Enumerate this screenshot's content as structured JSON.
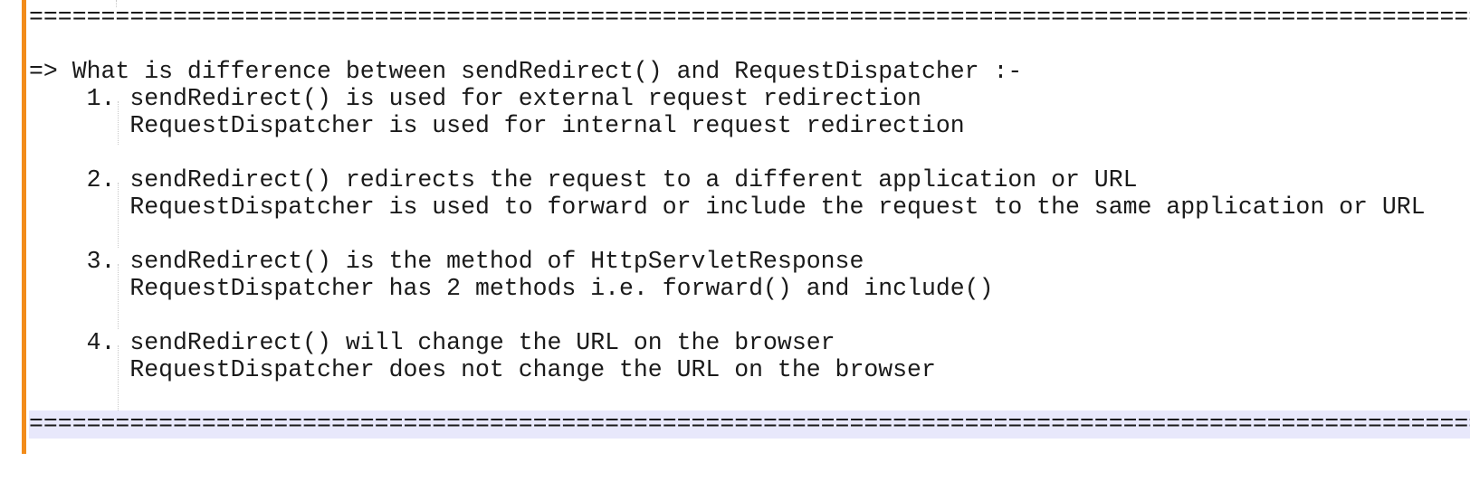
{
  "editor": {
    "lines": [
      "===========================================================================================================",
      "",
      "=> What is difference between sendRedirect() and RequestDispatcher :-",
      "    1. sendRedirect() is used for external request redirection",
      "       RequestDispatcher is used for internal request redirection",
      "",
      "    2. sendRedirect() redirects the request to a different application or URL",
      "       RequestDispatcher is used to forward or include the request to the same application or URL",
      "",
      "    3. sendRedirect() is the method of HttpServletResponse",
      "       RequestDispatcher has 2 methods i.e. forward() and include()",
      "",
      "    4. sendRedirect() will change the URL on the browser",
      "       RequestDispatcher does not change the URL on the browser",
      "",
      "==========================================================================================================="
    ],
    "current_line_index": 15,
    "colors": {
      "change_bar": "#f28c1b",
      "current_line_highlight": "#e8e8fb",
      "text": "#1a1a1a"
    }
  }
}
